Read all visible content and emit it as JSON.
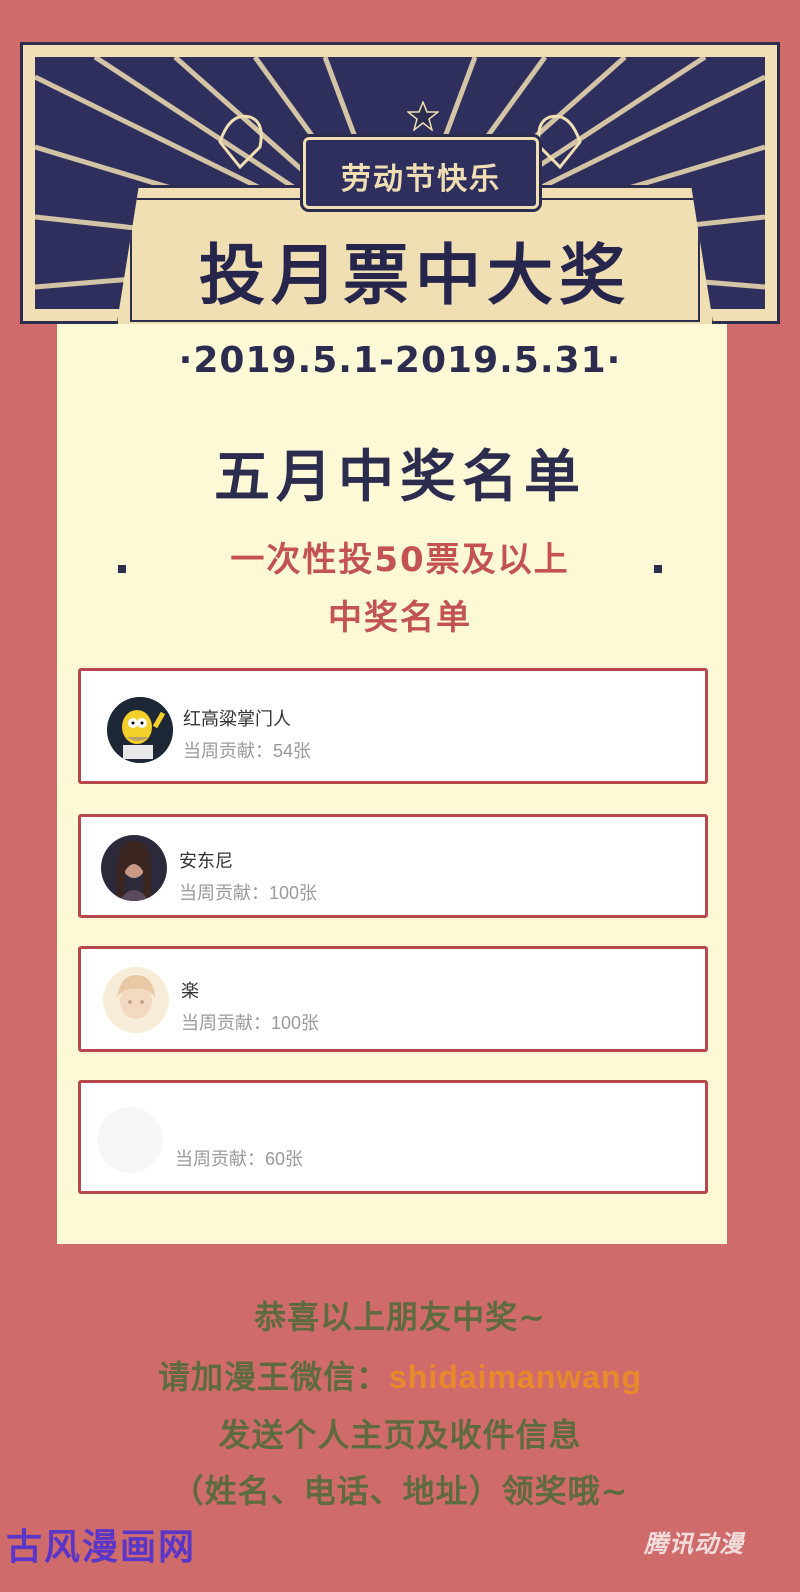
{
  "banner": {
    "holiday_label": "劳动节快乐",
    "main_title": "投月票中大奖"
  },
  "campaign": {
    "date_range": "·2019.5.1-2019.5.31·",
    "list_title": "五月中奖名单",
    "criteria": "一次性投50票及以上",
    "subheading": "中奖名单"
  },
  "winners": [
    {
      "name": "红高粱掌门人",
      "contribution": "当周贡献：54张",
      "avatar": "cartoon-avatar"
    },
    {
      "name": "安东尼",
      "contribution": "当周贡献：100张",
      "avatar": "portrait-avatar"
    },
    {
      "name": "楽",
      "contribution": "当周贡献：100张",
      "avatar": "illustration-avatar"
    },
    {
      "name": "",
      "contribution": "当周贡献：60张",
      "avatar": "blank-avatar"
    }
  ],
  "footer": {
    "line1": "恭喜以上朋友中奖~",
    "line2_prefix": "请加漫王微信：",
    "wechat_id": "shidaimanwang",
    "line3": "发送个人主页及收件信息",
    "line4": "（姓名、电话、地址）领奖哦~"
  },
  "watermarks": {
    "left": "古风漫画网",
    "right": "腾讯动漫"
  },
  "colors": {
    "page_bg": "#d06b6c",
    "panel_bg": "#fdf8d6",
    "navy": "#2b2c4e",
    "accent_red": "#c35255",
    "footer_green": "#5d6b3f",
    "wechat_orange": "#e98a2a"
  }
}
